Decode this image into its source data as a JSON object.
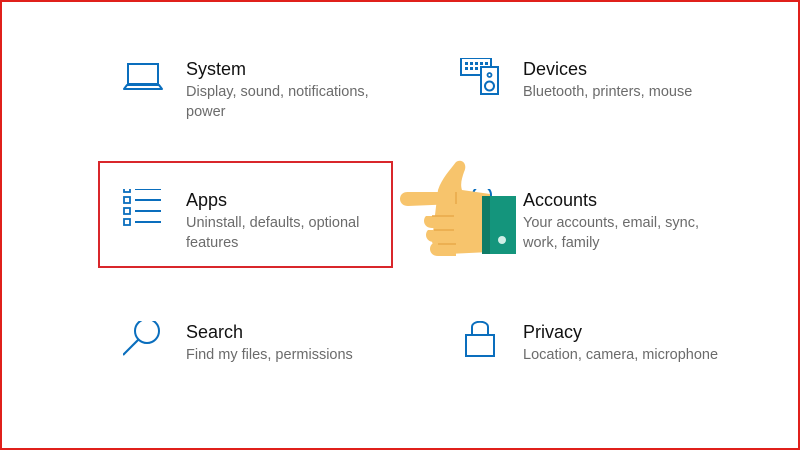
{
  "accent_color": "#0a6ebd",
  "highlight_color": "#d9262b",
  "tiles": [
    {
      "id": "system",
      "title": "System",
      "description": "Display, sound, notifications, power",
      "icon": "laptop-icon"
    },
    {
      "id": "devices",
      "title": "Devices",
      "description": "Bluetooth, printers, mouse",
      "icon": "keyboard-speaker-icon"
    },
    {
      "id": "apps",
      "title": "Apps",
      "description": "Uninstall, defaults, optional features",
      "icon": "app-list-icon",
      "highlighted": true
    },
    {
      "id": "accounts",
      "title": "Accounts",
      "description": "Your accounts, email, sync, work, family",
      "icon": "person-icon"
    },
    {
      "id": "search",
      "title": "Search",
      "description": "Find my files, permissions",
      "icon": "search-icon"
    },
    {
      "id": "privacy",
      "title": "Privacy",
      "description": "Location, camera, microphone",
      "icon": "lock-icon"
    }
  ],
  "pointer": {
    "icon": "pointing-hand-icon"
  }
}
